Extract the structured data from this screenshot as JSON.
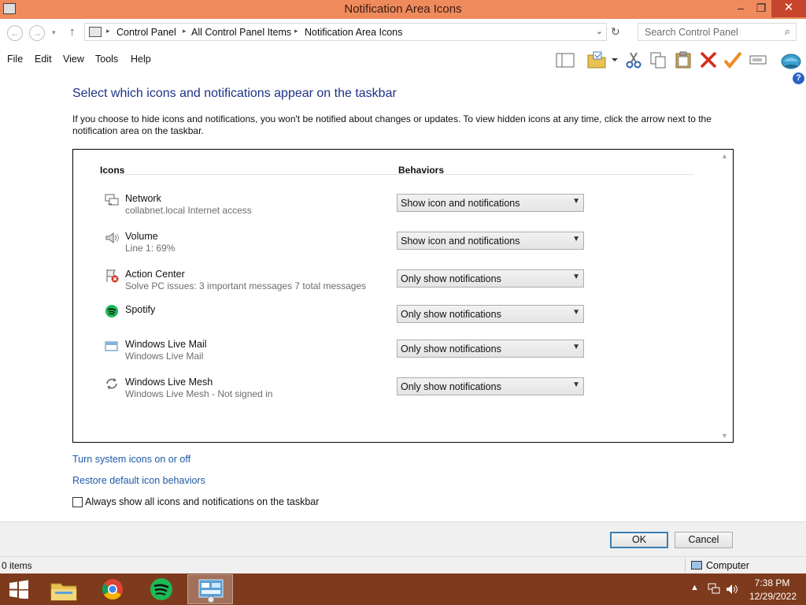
{
  "window": {
    "title": "Notification Area Icons",
    "minimize": "–",
    "maximize": "❐",
    "close": "✕"
  },
  "nav": {
    "back": "←",
    "forward": "→",
    "history": "▾",
    "up": "↑",
    "refresh": "↻",
    "dropdown": "⌄"
  },
  "breadcrumb": [
    "Control Panel",
    "All Control Panel Items",
    "Notification Area Icons"
  ],
  "search": {
    "placeholder": "Search Control Panel",
    "icon": "🔍"
  },
  "menu": [
    "File",
    "Edit",
    "View",
    "Tools",
    "Help"
  ],
  "toolbar_icons": [
    "preview-pane-icon",
    "folder-icon",
    "cut-icon",
    "copy-icon",
    "paste-icon",
    "delete-icon",
    "properties-check-icon",
    "rename-icon",
    "globe-icon"
  ],
  "help_icon": "?",
  "heading": "Select which icons and notifications appear on the taskbar",
  "description": "If you choose to hide icons and notifications, you won't be notified about changes or updates. To view hidden icons at any time, click the arrow next to the notification area on the taskbar.",
  "table": {
    "col_icons": "Icons",
    "col_behaviors": "Behaviors",
    "rows": [
      {
        "name": "Network",
        "desc": "collabnet.local Internet access",
        "behavior": "Show icon and notifications",
        "icon": "network-icon"
      },
      {
        "name": "Volume",
        "desc": "Line 1: 69%",
        "behavior": "Show icon and notifications",
        "icon": "speaker-icon"
      },
      {
        "name": "Action Center",
        "desc": "Solve PC issues: 3 important messages  7 total messages",
        "behavior": "Only show notifications",
        "icon": "action-center-flag-icon"
      },
      {
        "name": "Spotify",
        "desc": "",
        "behavior": "Only show notifications",
        "icon": "spotify-icon"
      },
      {
        "name": "Windows Live Mail",
        "desc": "Windows Live Mail",
        "behavior": "Only show notifications",
        "icon": "mail-icon"
      },
      {
        "name": "Windows Live Mesh",
        "desc": "Windows Live Mesh - Not signed in",
        "behavior": "Only show notifications",
        "icon": "sync-icon"
      }
    ]
  },
  "links": {
    "system_icons": "Turn system icons on or off",
    "restore": "Restore default icon behaviors"
  },
  "checkbox": {
    "label": "Always show all icons and notifications on the taskbar",
    "checked": false
  },
  "buttons": {
    "ok": "OK",
    "cancel": "Cancel"
  },
  "status": {
    "items": "0 items",
    "location": "Computer"
  },
  "taskbar": {
    "apps": [
      "file-explorer-icon",
      "chrome-icon",
      "spotify-icon",
      "control-panel-icon"
    ],
    "tray_arrow": "▲",
    "time": "7:38 PM",
    "date": "12/29/2022"
  },
  "colors": {
    "title_bar": "#ee8a5c",
    "taskbar": "#7e3a1c",
    "heading": "#1e3287",
    "link": "#1e5aa8"
  }
}
